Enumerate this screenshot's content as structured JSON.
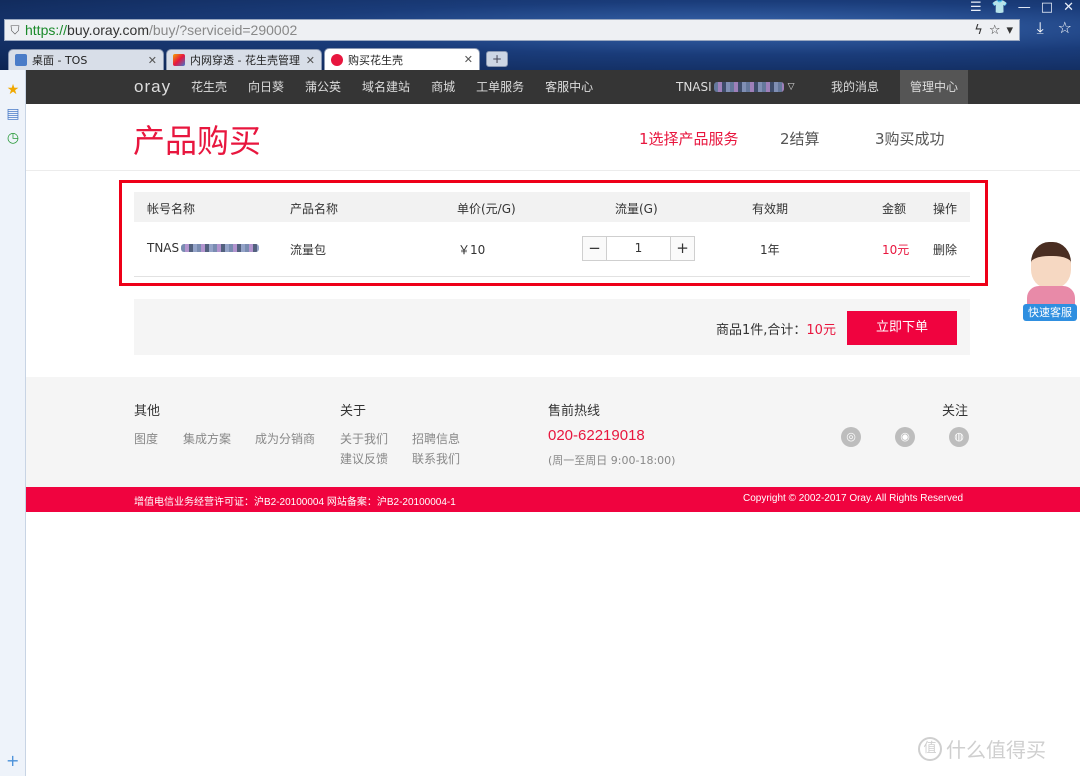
{
  "browser": {
    "url_scheme": "https://",
    "url_host": "buy.oray.com",
    "url_path": "/buy/?serviceid=290002",
    "tabs": [
      {
        "label": "桌面 - TOS",
        "active": false
      },
      {
        "label": "内网穿透 - 花生壳管理",
        "active": false
      },
      {
        "label": "购买花生壳",
        "active": true
      }
    ]
  },
  "nav": {
    "logo": "oray",
    "links": [
      "花生壳",
      "向日葵",
      "蒲公英",
      "域名建站",
      "商城",
      "工单服务",
      "客服中心"
    ],
    "user": "TNASI",
    "messages": "我的消息",
    "manage": "管理中心"
  },
  "header": {
    "title": "产品购买",
    "steps": [
      "1选择产品服务",
      "2结算",
      "3购买成功"
    ]
  },
  "table": {
    "headers": [
      "帐号名称",
      "产品名称",
      "单价(元/G)",
      "流量(G)",
      "有效期",
      "金额",
      "操作"
    ],
    "row": {
      "account": "TNAS",
      "product": "流量包",
      "price": "￥10",
      "quantity": "1",
      "validity": "1年",
      "amount": "10元",
      "action": "删除"
    }
  },
  "summary": {
    "prefix": "商品1件,合计：",
    "amount": "10元",
    "order_button": "立即下单"
  },
  "footer": {
    "col1": {
      "title": "其他",
      "links": [
        "图度",
        "集成方案",
        "成为分销商"
      ]
    },
    "col2": {
      "title": "关于",
      "links": [
        "关于我们",
        "招聘信息",
        "建议反馈",
        "联系我们"
      ]
    },
    "col3": {
      "title": "售前热线",
      "phone": "020-62219018",
      "hours": "(周一至周日 9:00-18:00)"
    },
    "col4": {
      "title": "关注"
    },
    "license": "增值电信业务经营许可证：沪B2-20100004 网站备案：沪B2-20100004-1",
    "copyright": "Copyright © 2002-2017 Oray. All Rights Reserved"
  },
  "kefu_label": "快速客服",
  "watermark": "什么值得买"
}
